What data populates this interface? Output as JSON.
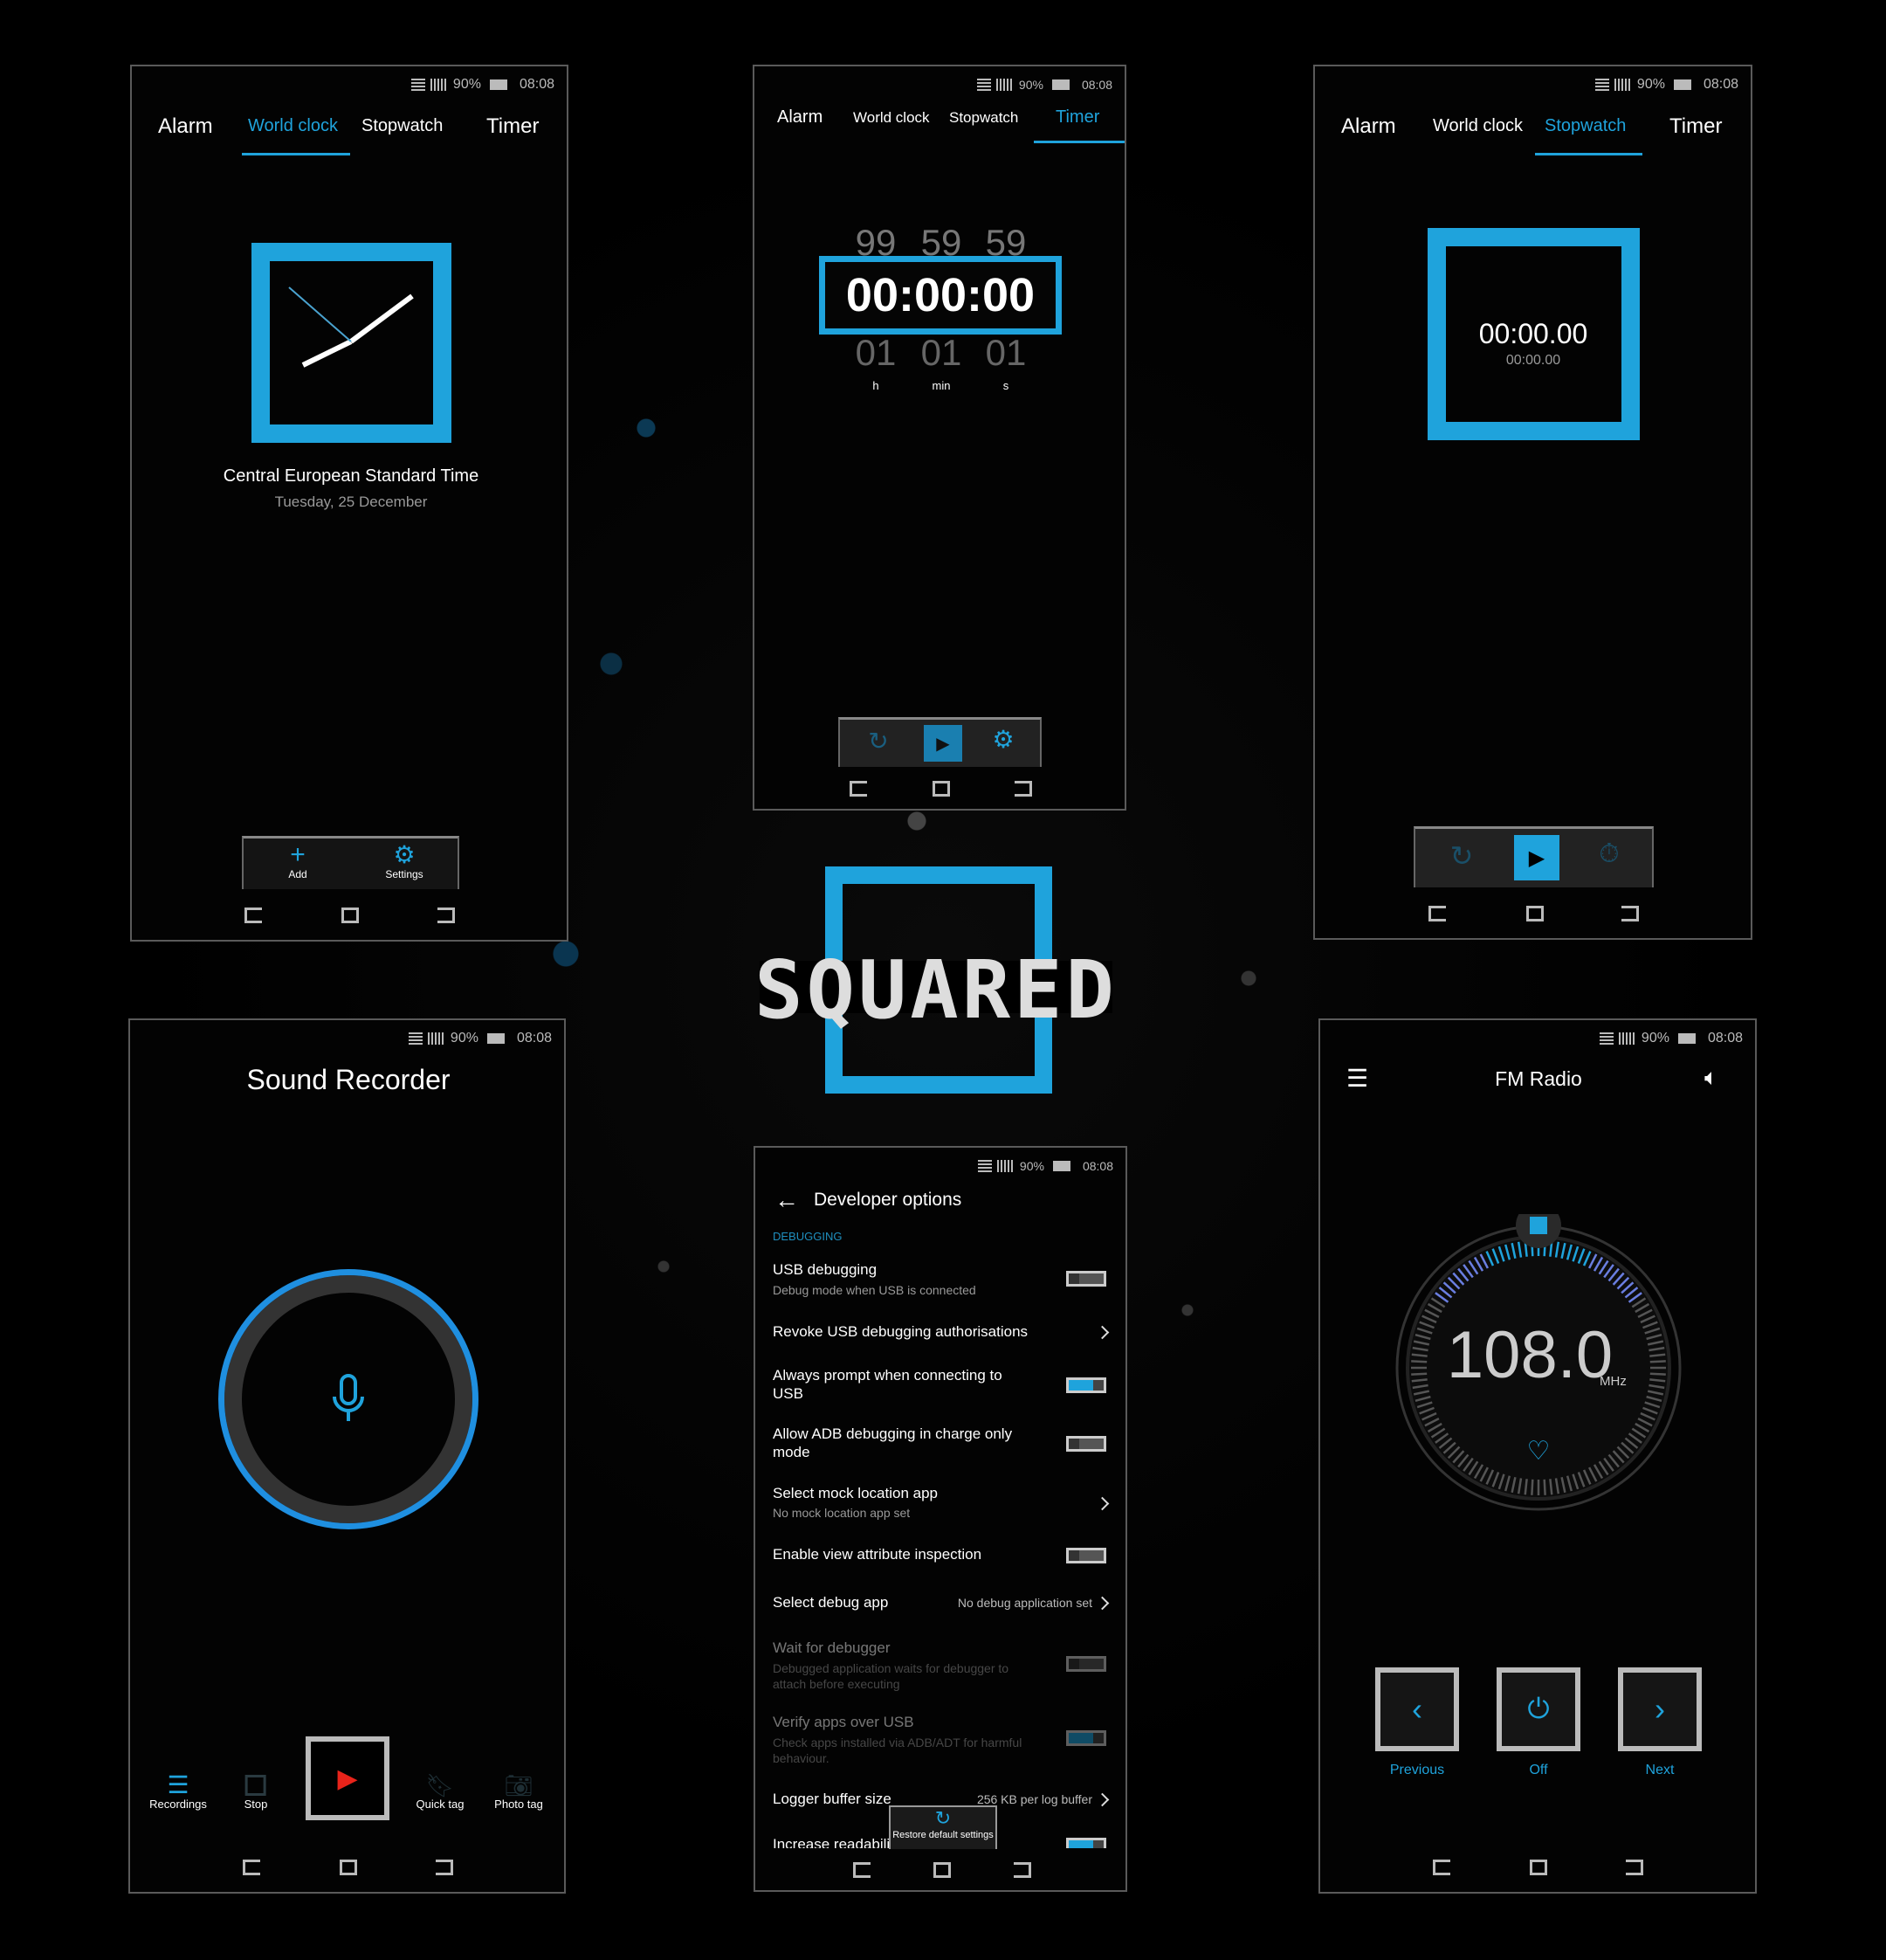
{
  "status": {
    "battery": "90%",
    "time": "08:08"
  },
  "clock_tabs": [
    "Alarm",
    "World clock",
    "Stopwatch",
    "Timer"
  ],
  "colors": {
    "accent": "#1fa3dc",
    "record": "#e8231a",
    "background": "#000000"
  },
  "world_clock": {
    "active_tab": "World clock",
    "timezone": "Central European Standard Time",
    "date": "Tuesday, 25 December",
    "add_label": "Add",
    "settings_label": "Settings"
  },
  "timer": {
    "active_tab": "Timer",
    "above": [
      "99",
      "59",
      "59"
    ],
    "value": "00:00:00",
    "below": [
      "01",
      "01",
      "01"
    ],
    "units": [
      "h",
      "min",
      "s"
    ]
  },
  "stopwatch": {
    "active_tab": "Stopwatch",
    "main": "00:00.00",
    "lap": "00:00.00"
  },
  "logo": {
    "text": "SQUARED"
  },
  "recorder": {
    "title": "Sound Recorder",
    "actions": [
      "Recordings",
      "Stop",
      "Quick tag",
      "Photo tag"
    ]
  },
  "developer": {
    "title": "Developer options",
    "section": "DEBUGGING",
    "rows": [
      {
        "title": "USB debugging",
        "subtitle": "Debug mode when USB is connected",
        "toggle": false
      },
      {
        "title": "Revoke USB debugging authorisations"
      },
      {
        "title": "Always prompt when connecting to",
        "title2": "USB",
        "toggle": true
      },
      {
        "title": "Allow ADB debugging in charge only",
        "title2": "mode",
        "toggle": false
      },
      {
        "title": "Select mock location app",
        "subtitle": "No mock location app set"
      },
      {
        "title": "Enable view attribute inspection",
        "toggle": false
      },
      {
        "title": "Select debug app",
        "value": "No debug application set"
      },
      {
        "title": "Wait for debugger",
        "subtitle": "Debugged application waits for debugger to",
        "subtitle2": "attach before executing",
        "toggle": false,
        "disabled": true
      },
      {
        "title": "Verify apps over USB",
        "subtitle": "Check apps installed via ADB/ADT for harmful",
        "subtitle2": "behaviour.",
        "toggle": true,
        "disabled": true
      },
      {
        "title": "Logger buffer size",
        "value": "256 KB per log buffer"
      },
      {
        "title": "Increase readability in sunlight",
        "toggle": true
      }
    ],
    "toast": "Restore default settings"
  },
  "fm": {
    "title": "FM Radio",
    "frequency": "108.0",
    "unit": "MHz",
    "buttons": [
      "Previous",
      "Off",
      "Next"
    ]
  }
}
